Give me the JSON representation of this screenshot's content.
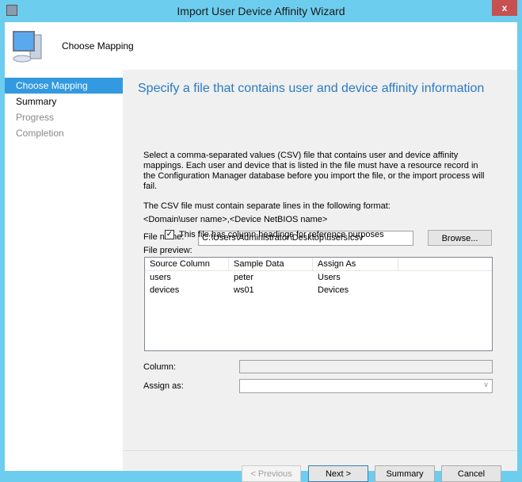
{
  "window": {
    "title": "Import User Device Affinity Wizard",
    "close_label": "x"
  },
  "header": {
    "title": "Choose Mapping"
  },
  "nav": {
    "items": [
      {
        "label": "Choose Mapping"
      },
      {
        "label": "Summary"
      },
      {
        "label": "Progress"
      },
      {
        "label": "Completion"
      }
    ]
  },
  "main": {
    "heading": "Specify a file that contains user and device affinity information",
    "description": "Select a comma-separated values (CSV) file that contains user and device affinity mappings. Each user and device that is listed in the file must have a resource record in the Configuration Manager database before you import the file, or the import process will fail.",
    "format_intro": "The CSV file must contain separate lines in the following format:",
    "format": "<Domain\\user name>,<Device NetBIOS name>",
    "file_name_label": "File name:",
    "file_name_value": "C:\\Users\\Administrator\\Desktop\\users.csv",
    "browse_label": "Browse...",
    "headings_checkbox_label": "This file has column headings for reference purposes",
    "headings_checked": true,
    "preview_label": "File preview:",
    "preview": {
      "columns": [
        "Source Column",
        "Sample Data",
        "Assign As"
      ],
      "rows": [
        [
          "users",
          "peter",
          "Users"
        ],
        [
          "devices",
          "ws01",
          "Devices"
        ]
      ]
    },
    "column_label": "Column:",
    "column_value": "",
    "assign_label": "Assign as:",
    "assign_value": ""
  },
  "buttons": {
    "previous": "< Previous",
    "next": "Next >",
    "summary": "Summary",
    "cancel": "Cancel"
  }
}
